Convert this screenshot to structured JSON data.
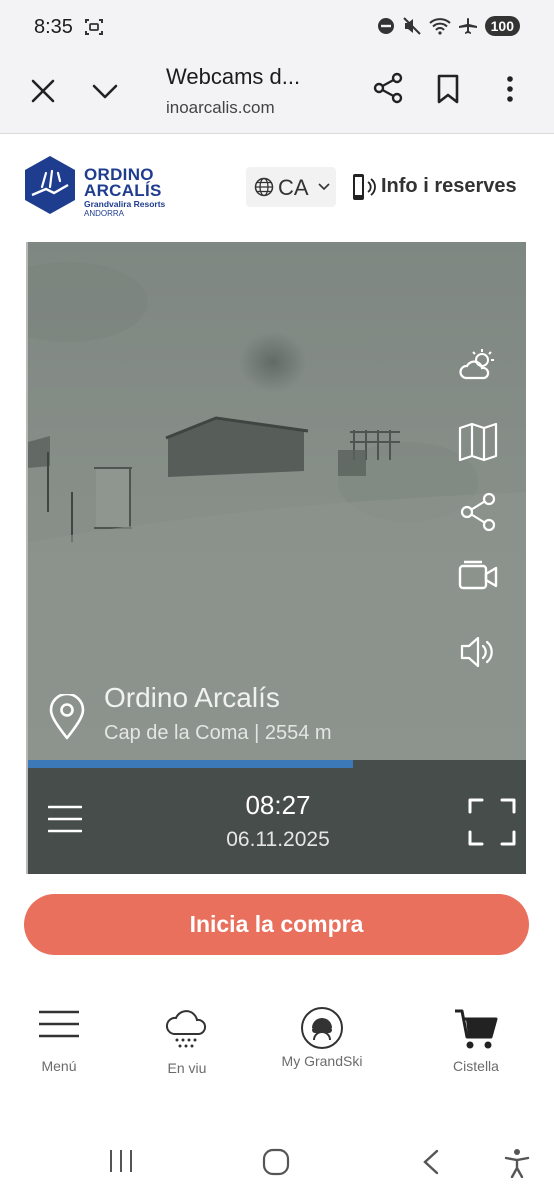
{
  "status_bar": {
    "time": "8:35",
    "battery": "100"
  },
  "browser": {
    "page_title": "Webcams d...",
    "url": "inoarcalis.com"
  },
  "site_header": {
    "brand_line1": "ORDINO",
    "brand_line2": "ARCALÍS",
    "brand_line3": "Grandvalira Resorts",
    "brand_line4": "ANDORRA",
    "language": "CA",
    "info_label": "Info i reserves",
    "brand_color": "#1f3d8f"
  },
  "webcam": {
    "location_name": "Ordino Arcalís",
    "location_detail": "Cap de la Coma | 2554 m",
    "time": "08:27",
    "date": "06.11.2025",
    "playback_progress": 0.65,
    "controls": [
      "weather-icon",
      "map-icon",
      "share-icon",
      "video-camera-icon",
      "speaker-icon"
    ],
    "progress_color": "#3c79b9"
  },
  "purchase": {
    "button_label": "Inicia la compra",
    "button_color": "#e8705d"
  },
  "bottom_nav": {
    "items": [
      {
        "label": "Menú",
        "icon": "hamburger-icon"
      },
      {
        "label": "En viu",
        "icon": "snow-cloud-icon"
      },
      {
        "label": "My GrandSki",
        "icon": "skier-avatar-icon"
      },
      {
        "label": "Cistella",
        "icon": "cart-icon"
      }
    ]
  }
}
